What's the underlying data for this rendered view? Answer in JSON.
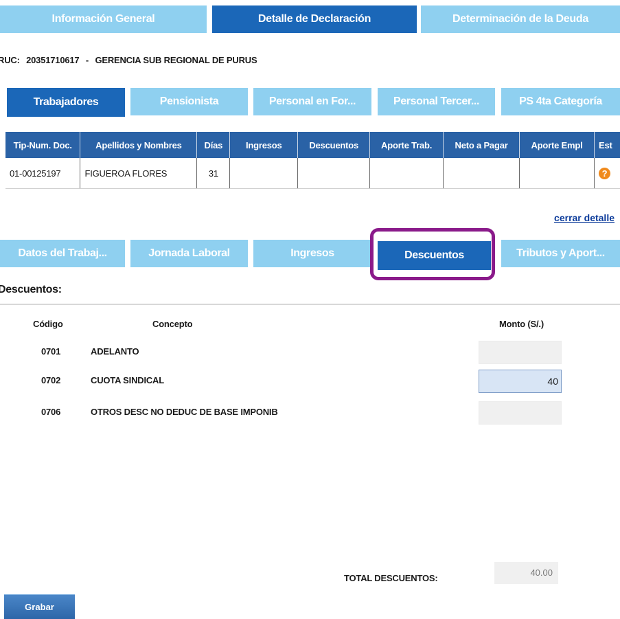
{
  "top_tabs": [
    {
      "label": "Información General",
      "active": false
    },
    {
      "label": "Detalle de Declaración",
      "active": true
    },
    {
      "label": "Determinación de la Deuda",
      "active": false
    }
  ],
  "header": {
    "ruc_label": "RUC:",
    "ruc_number": "20351710617",
    "separator": "-",
    "company": "GERENCIA SUB REGIONAL DE PURUS"
  },
  "worker_tabs": [
    {
      "label": "Trabajadores",
      "active": true
    },
    {
      "label": "Pensionista",
      "active": false
    },
    {
      "label": "Personal en For...",
      "active": false
    },
    {
      "label": "Personal Tercer...",
      "active": false
    },
    {
      "label": "PS 4ta Categoría",
      "active": false
    }
  ],
  "table": {
    "columns": [
      "Tip-Num. Doc.",
      "Apellidos y Nombres",
      "Días",
      "Ingresos",
      "Descuentos",
      "Aporte Trab.",
      "Neto a Pagar",
      "Aporte Empl",
      "Est"
    ],
    "rows": [
      {
        "doc": "01-00125197",
        "name": "FIGUEROA FLORES",
        "days": "31",
        "ingresos": "",
        "descuentos": "",
        "aporte_trab": "",
        "neto": "",
        "aporte_empl": "",
        "status_icon": "help-icon",
        "status_glyph": "?"
      }
    ]
  },
  "close_link": "cerrar detalle",
  "detail_tabs": [
    {
      "label": "Datos del Trabaj...",
      "active": false
    },
    {
      "label": "Jornada Laboral",
      "active": false
    },
    {
      "label": "Ingresos",
      "active": false
    },
    {
      "label": "Descuentos",
      "active": true
    },
    {
      "label": "Tributos y Aport...",
      "active": false
    }
  ],
  "section": {
    "title": "Descuentos:",
    "col_code": "Código",
    "col_concept": "Concepto",
    "col_amount": "Monto (S/.)",
    "items": [
      {
        "code": "0701",
        "concept": "ADELANTO",
        "amount": ""
      },
      {
        "code": "0702",
        "concept": "CUOTA SINDICAL",
        "amount": "40"
      },
      {
        "code": "0706",
        "concept": "OTROS DESC NO DEDUC DE BASE IMPONIB",
        "amount": ""
      }
    ],
    "total_label": "TOTAL DESCUENTOS:",
    "total_value": "40.00"
  },
  "save_button": "Grabar",
  "colors": {
    "light_tab": "#8fd0f0",
    "dark_tab": "#1b67b8",
    "table_header": "#2a62a6",
    "highlight": "#8a1a8a"
  }
}
